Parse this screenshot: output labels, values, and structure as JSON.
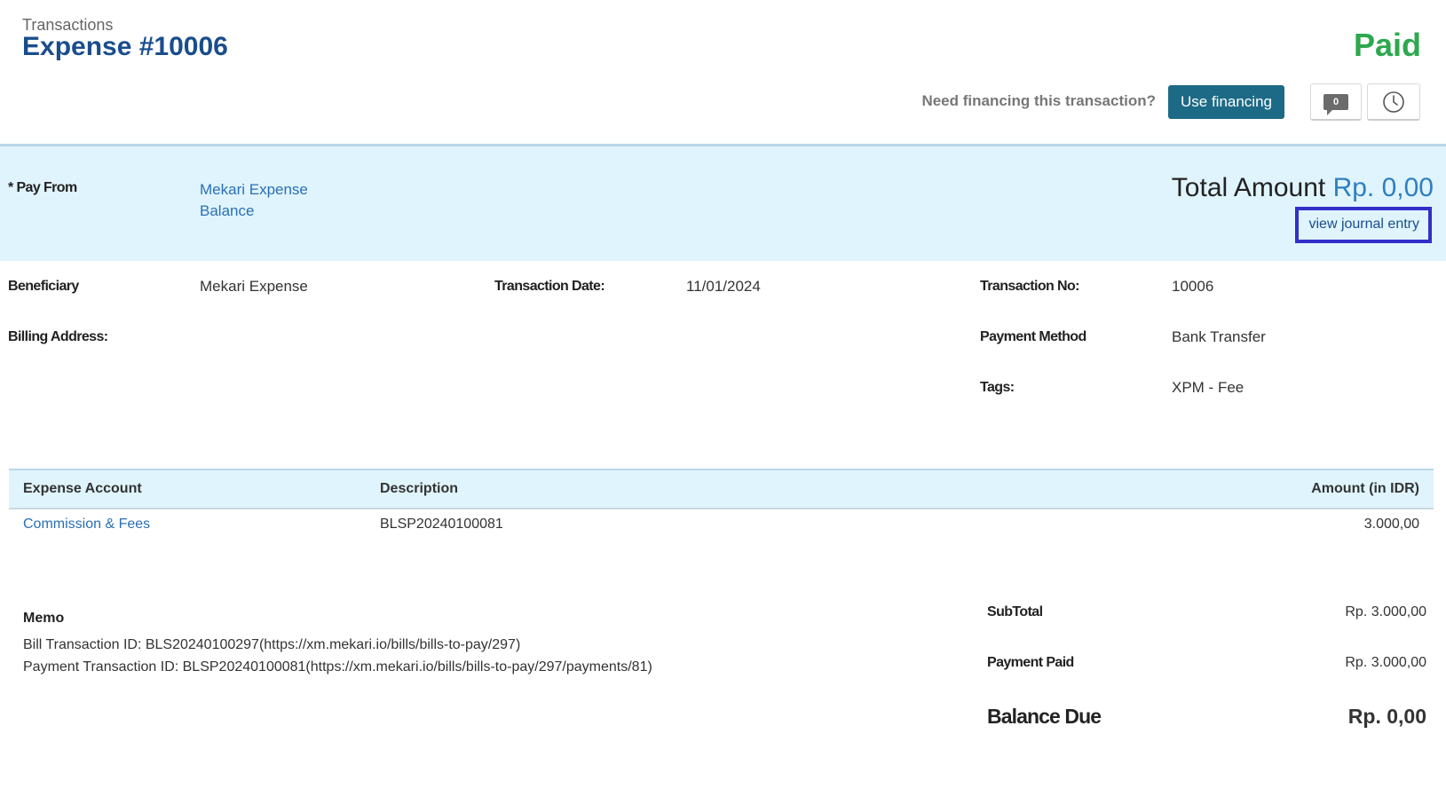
{
  "header": {
    "breadcrumb": "Transactions",
    "title": "Expense #10006",
    "status": "Paid",
    "status_color": "#2ea84f",
    "financing_prompt": "Need financing this transaction?",
    "financing_button": "Use financing",
    "comment_count": "0",
    "comment_icon": "comment-icon",
    "history_icon": "clock-icon"
  },
  "pay_from": {
    "label": "* Pay From",
    "value_line1": "Mekari Expense",
    "value_line2": "Balance",
    "total_label": "Total Amount",
    "total_value": "Rp. 0,00",
    "journal_link": "view journal entry"
  },
  "details": {
    "beneficiary_label": "Beneficiary",
    "beneficiary_value": "Mekari Expense",
    "billing_label": "Billing Address:",
    "date_label": "Transaction Date:",
    "date_value": "11/01/2024",
    "txn_no_label": "Transaction No:",
    "txn_no_value": "10006",
    "payment_method_label": "Payment Method",
    "payment_method_value": "Bank Transfer",
    "tags_label": "Tags:",
    "tags_value": "XPM - Fee"
  },
  "table": {
    "headers": [
      "Expense Account",
      "Description",
      "Amount (in IDR)"
    ],
    "rows": [
      {
        "account": "Commission & Fees",
        "description": "BLSP20240100081",
        "amount": "3.000,00"
      }
    ]
  },
  "memo": {
    "title": "Memo",
    "line1": "Bill Transaction ID: BLS20240100297(https://xm.mekari.io/bills/bills-to-pay/297)",
    "line2": "Payment Transaction ID: BLSP20240100081(https://xm.mekari.io/bills/bills-to-pay/297/payments/81)"
  },
  "totals": {
    "subtotal_label": "SubTotal",
    "subtotal_value": "Rp. 3.000,00",
    "paid_label": "Payment Paid",
    "paid_value": "Rp. 3.000,00",
    "balance_label": "Balance Due",
    "balance_value": "Rp. 0,00"
  }
}
